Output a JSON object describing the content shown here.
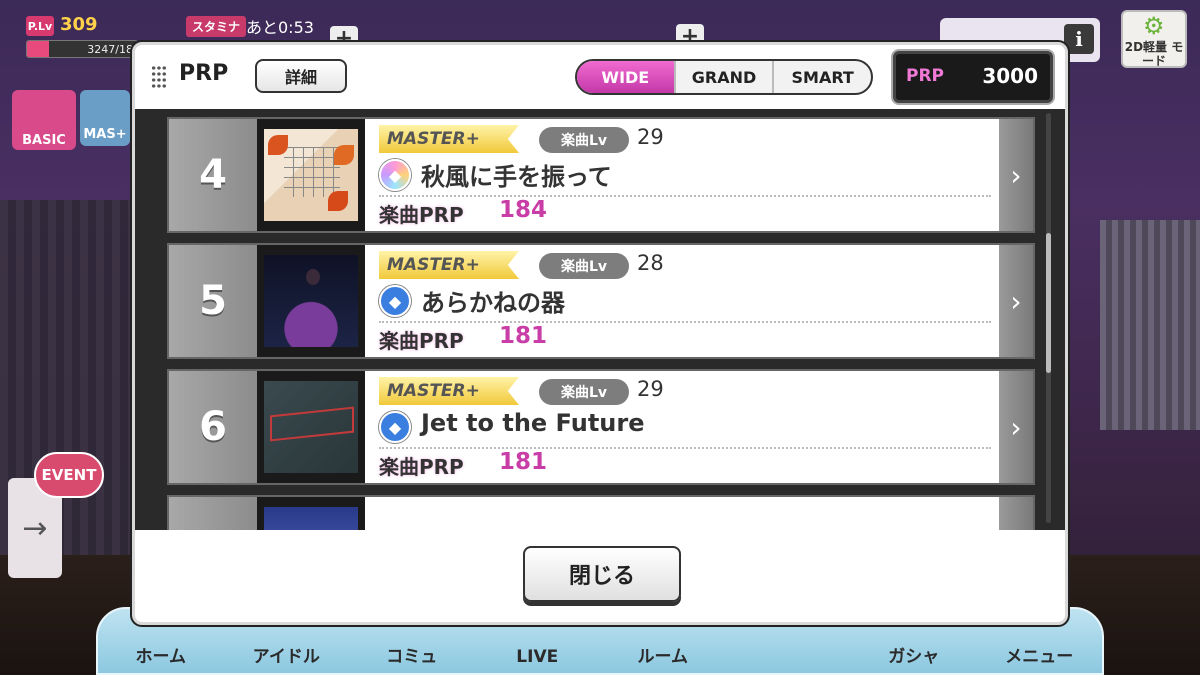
{
  "hud": {
    "plv_label": "P.Lv",
    "plv_value": "309",
    "exp_text": "3247/18",
    "stamina_label": "スタミナ",
    "stamina_time": "あと0:53",
    "mode_2d_label": "2D軽量 モード",
    "basic_label": "BASIC",
    "mas_label": "MAS+",
    "event_label": "EVENT"
  },
  "modal": {
    "title": "PRP",
    "detail_button": "詳細",
    "tabs": [
      "WIDE",
      "GRAND",
      "SMART"
    ],
    "active_tab": "WIDE",
    "prp_label": "PRP",
    "prp_value": "3000",
    "close_button": "閉じる"
  },
  "songs": [
    {
      "rank": "4",
      "difficulty": "MASTER+",
      "level_label": "楽曲Lv",
      "level": "29",
      "type_icon": "all-type-icon",
      "title": "秋風に手を振って",
      "prp_label": "楽曲PRP",
      "prp": "184"
    },
    {
      "rank": "5",
      "difficulty": "MASTER+",
      "level_label": "楽曲Lv",
      "level": "28",
      "type_icon": "cool-type-icon",
      "title": "あらかねの器",
      "prp_label": "楽曲PRP",
      "prp": "181"
    },
    {
      "rank": "6",
      "difficulty": "MASTER+",
      "level_label": "楽曲Lv",
      "level": "29",
      "type_icon": "cool-type-icon",
      "title": "Jet to the Future",
      "prp_label": "楽曲PRP",
      "prp": "181"
    }
  ],
  "nav": {
    "items": [
      "ホーム",
      "アイドル",
      "コミュ",
      "LIVE",
      "ルーム",
      "",
      "ガシャ",
      "メニュー"
    ]
  },
  "colors": {
    "active_tab": "#d94fbf",
    "song_prp": "#c93ea6",
    "cool_type": "#3a7ee0"
  }
}
